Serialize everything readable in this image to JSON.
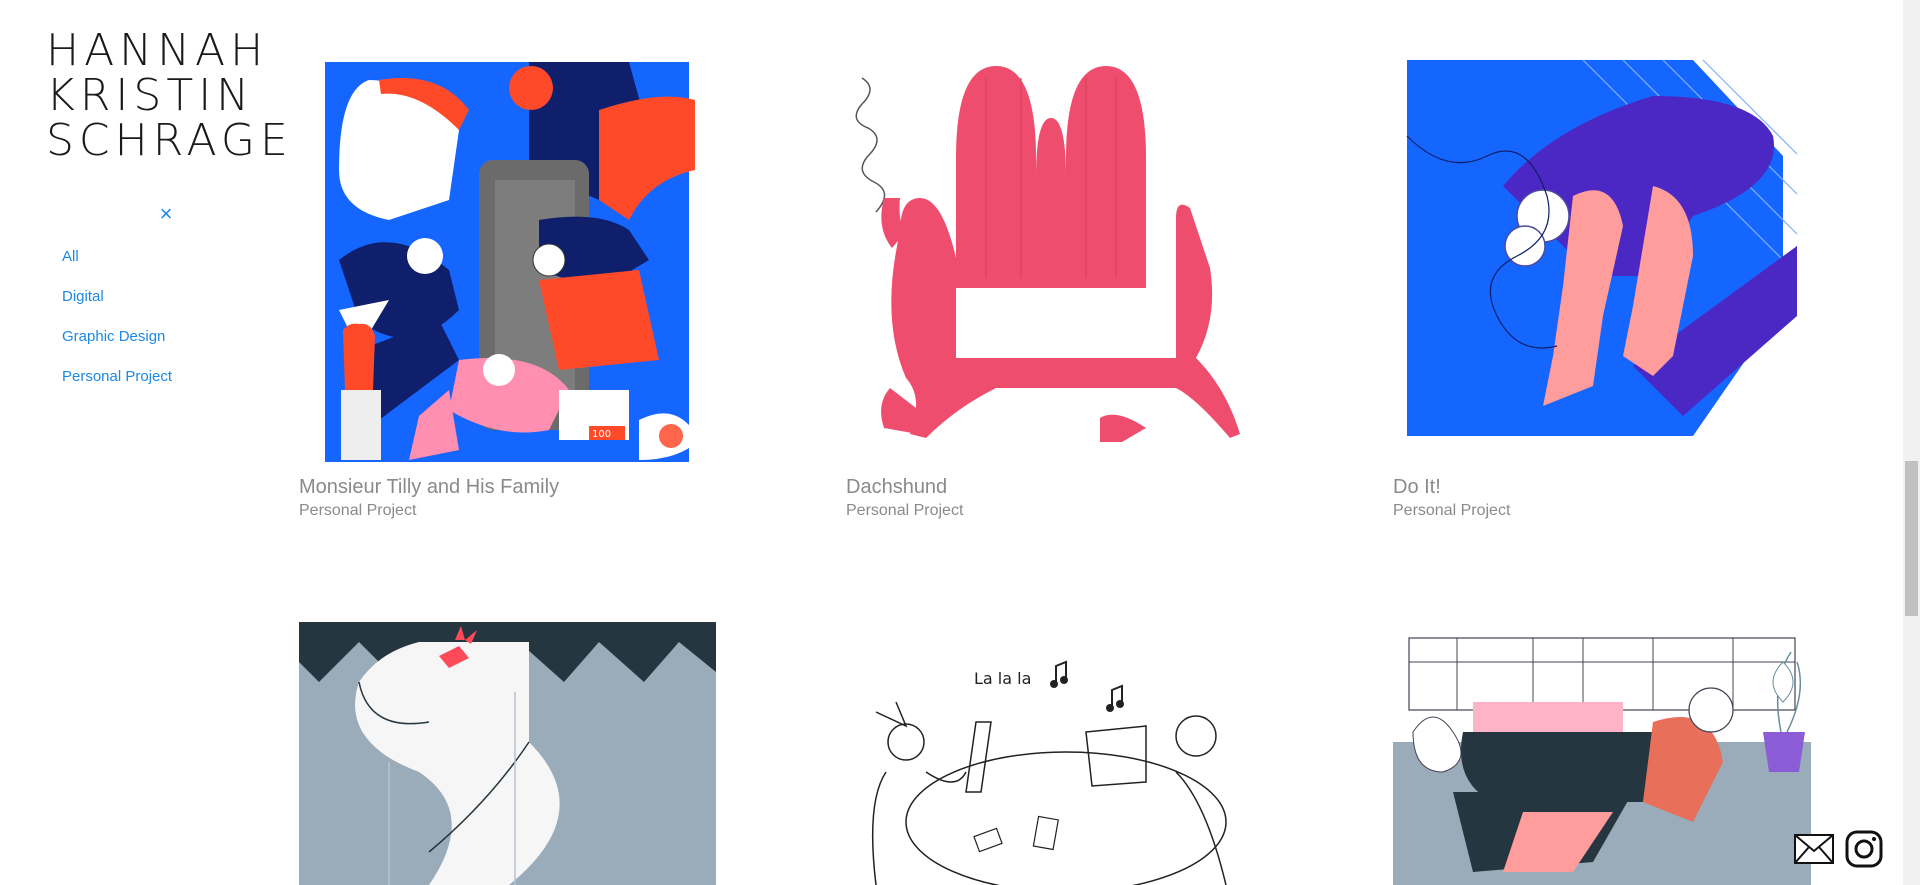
{
  "brand": {
    "logo_lines": [
      "HANNAH",
      "KRISTIN",
      "SCHRAGE"
    ]
  },
  "sidebar": {
    "close_icon": "×",
    "filters": [
      {
        "label": "All"
      },
      {
        "label": "Digital"
      },
      {
        "label": "Graphic Design"
      },
      {
        "label": "Personal Project"
      }
    ]
  },
  "projects": [
    {
      "title": "Monsieur Tilly and His Family",
      "category": "Personal Project"
    },
    {
      "title": "Dachshund",
      "category": "Personal Project"
    },
    {
      "title": "Do It!",
      "category": "Personal Project"
    }
  ],
  "illustration_text": {
    "lalala": "La la la",
    "sign": "100"
  },
  "icons": {
    "mail": "mail-icon",
    "instagram": "instagram-icon"
  },
  "colors": {
    "accent": "#1e88e5",
    "caption": "#8a8a8a",
    "blue": "#1565ff",
    "navy": "#0f1f6b",
    "red": "#ff4a2a",
    "pink": "#ee4d6e",
    "gray_blue": "#9aabba",
    "dark": "#263640"
  }
}
